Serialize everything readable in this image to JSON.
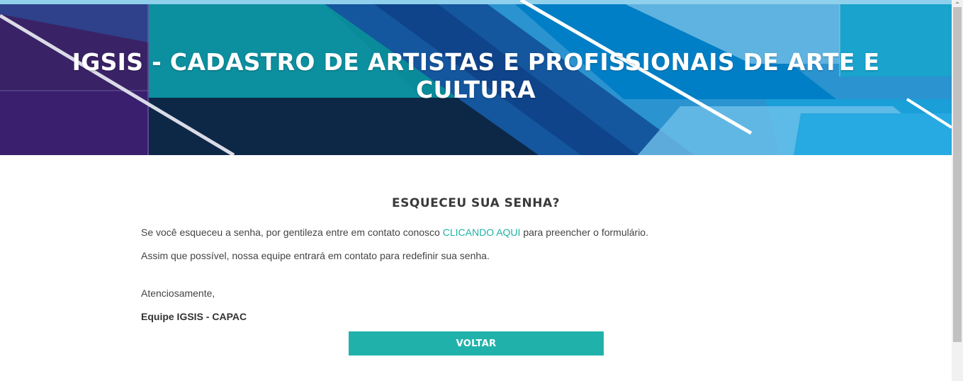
{
  "header": {
    "title": "IGSIS - CADASTRO DE ARTISTAS E PROFISSIONAIS DE ARTE E CULTURA"
  },
  "main": {
    "title": "ESQUECEU SUA SENHA?",
    "paragraph1_before": "Se você esqueceu a senha, por gentileza entre em contato conosco ",
    "paragraph1_link": "CLICANDO AQUI",
    "paragraph1_after": " para preencher o formulário.",
    "paragraph2": "Assim que possível, nossa equipe entrará em contato para redefinir sua senha.",
    "regards": "Atenciosamente,",
    "signature": "Equipe IGSIS - CAPAC",
    "back_button": "VOLTAR"
  },
  "colors": {
    "accent": "#20b2aa",
    "link": "#1fb2a6",
    "text": "#444444"
  }
}
